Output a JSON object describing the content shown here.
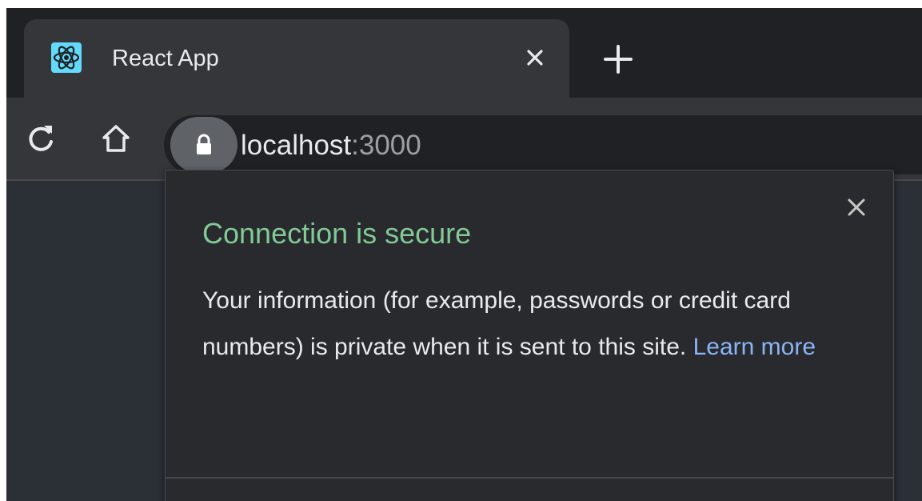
{
  "browser": {
    "tab": {
      "title": "React App",
      "favicon": "react-logo-icon",
      "close": "close-icon"
    },
    "new_tab": "plus-icon",
    "toolbar": {
      "reload": "reload-icon",
      "home": "home-icon"
    },
    "omnibox": {
      "lock": "lock-icon",
      "host": "localhost",
      "port": ":3000"
    }
  },
  "security_popup": {
    "heading": "Connection is secure",
    "body": "Your information (for example, passwords or credit card numbers) is private when it is sent to this site.",
    "link": "Learn more",
    "close": "close-icon"
  },
  "colors": {
    "secure_green": "#81c995",
    "link_blue": "#8ab4f8",
    "react_cyan": "#61dafb"
  }
}
